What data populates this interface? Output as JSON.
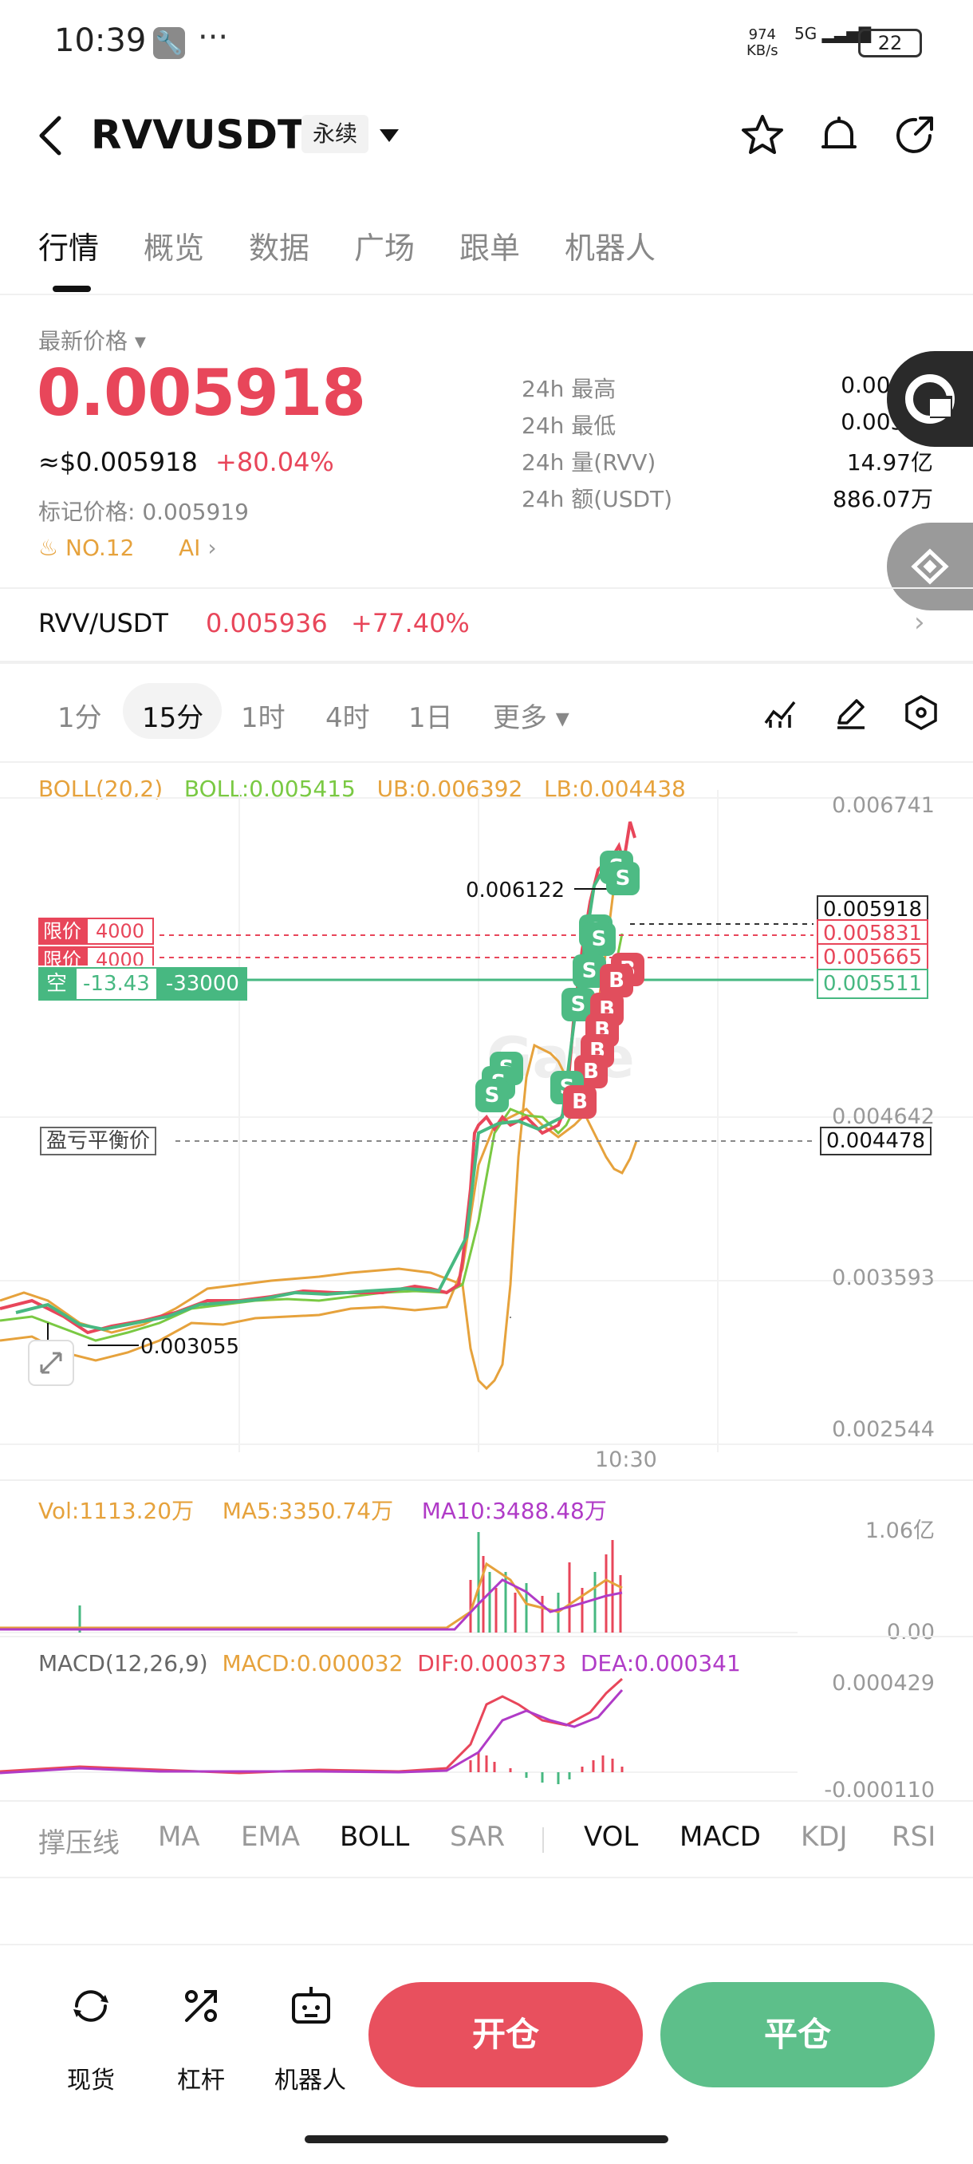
{
  "status_bar": {
    "time": "10:39",
    "speed": "974",
    "speed_unit": "KB/s",
    "network": "5G",
    "battery": "22"
  },
  "header": {
    "symbol": "RVVUSDT",
    "contract_type": "永续"
  },
  "tabs": [
    "行情",
    "概览",
    "数据",
    "广场",
    "跟单",
    "机器人"
  ],
  "ticker": {
    "latest_label": "最新价格",
    "price": "0.005918",
    "usd_price": "≈$0.005918",
    "change": "+80.04%",
    "mark_price": "标记价格: 0.005919",
    "rank": "NO.12",
    "ai": "AI"
  },
  "stats": [
    {
      "k": "24h  最高",
      "v": "0.00612"
    },
    {
      "k": "24h  最低",
      "v": "0.00328"
    },
    {
      "k": "24h  量(RVV)",
      "v": "14.97亿"
    },
    {
      "k": "24h  额(USDT)",
      "v": "886.07万"
    }
  ],
  "spot": {
    "pair": "RVV/USDT",
    "price": "0.005936",
    "change": "+77.40%"
  },
  "intervals": [
    "1分",
    "15分",
    "1时",
    "4时",
    "1日",
    "更多"
  ],
  "active_interval": "15分",
  "boll": {
    "name": "BOLL(20,2)",
    "mid": "BOLL:0.005415",
    "ub": "UB:0.006392",
    "lb": "LB:0.004438"
  },
  "price_axis": [
    "0.006741",
    "0.004642",
    "0.003593",
    "0.002544"
  ],
  "chart_labels": {
    "high": "0.006122",
    "low": "0.003055",
    "time": "10:30",
    "last": "0.005918",
    "order1": "0.005831",
    "order2": "0.005665",
    "position": "0.005511",
    "breakeven": "0.004478",
    "breakeven_label": "盈亏平衡价",
    "limit_label": "限价",
    "limit_qty": "4000",
    "short_label": "空",
    "short_pnl": "-13.43",
    "short_qty": "-33000",
    "watermark": "Gate"
  },
  "volume": {
    "vol": "Vol:1113.20万",
    "ma5": "MA5:3350.74万",
    "ma10": "MA10:3488.48万",
    "axis_top": "1.06亿",
    "axis_bottom": "0.00"
  },
  "macd": {
    "name": "MACD(12,26,9)",
    "macd": "MACD:0.000032",
    "dif": "DIF:0.000373",
    "dea": "DEA:0.000341",
    "axis_top": "0.000429",
    "axis_bottom": "-0.000110"
  },
  "indicator_tabs": [
    "撑压线",
    "MA",
    "EMA",
    "BOLL",
    "SAR",
    "VOL",
    "MACD",
    "KDJ",
    "RSI"
  ],
  "bottom_nav": {
    "spot": "现货",
    "leverage": "杠杆",
    "robot": "机器人",
    "open": "开仓",
    "close": "平仓"
  },
  "colors": {
    "up": "#e8465a",
    "down": "#47b881",
    "boll_mid": "#7ac943",
    "boll_band": "#e6a23c",
    "ma10": "#b03bc7"
  }
}
